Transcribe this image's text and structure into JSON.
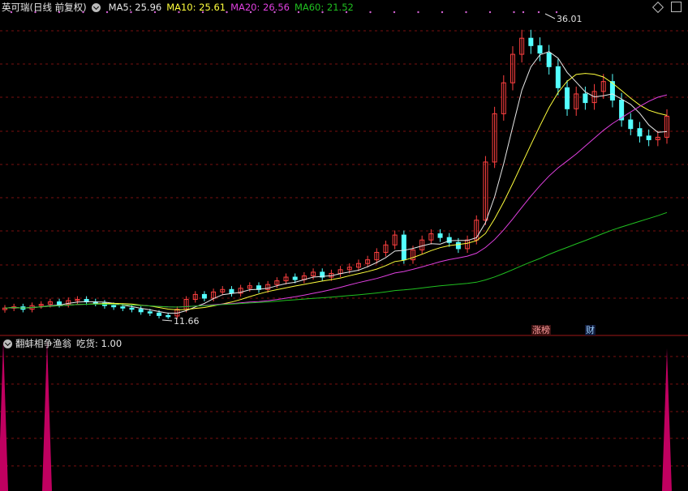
{
  "header": {
    "title": "英可瑞(日线 前复权)",
    "ma5": "MA5: 25.96",
    "ma10": "MA10: 25.61",
    "ma20": "MA20: 26.56",
    "ma60": "MA60: 21.52"
  },
  "annotations": {
    "high_label": "36.01",
    "low_label": "11.66",
    "badge1": "涨榜",
    "badge2": "财"
  },
  "indicator": {
    "title": "翻蚌相争渔翁",
    "value_label": "吃货: 1.00"
  },
  "colors": {
    "up": "#ff4040",
    "down": "#54ffff",
    "ma5": "#e8e8e8",
    "ma10": "#ffff3c",
    "ma20": "#e040e0",
    "ma60": "#20c020",
    "grid": "#7a1010",
    "indicator": "#c00060"
  },
  "chart_data": {
    "type": "candlestick",
    "y_range": [
      11.66,
      36.01
    ],
    "prices": {
      "close_series_approx": [
        12.3,
        12.4,
        12.2,
        12.5,
        12.6,
        12.8,
        12.6,
        12.9,
        13.0,
        12.8,
        12.7,
        12.5,
        12.4,
        12.3,
        12.2,
        12.0,
        11.9,
        11.7,
        11.66,
        12.2,
        13.0,
        13.4,
        13.1,
        13.6,
        13.8,
        13.5,
        13.9,
        14.1,
        13.8,
        14.2,
        14.5,
        14.8,
        14.6,
        14.9,
        15.2,
        14.8,
        15.1,
        15.4,
        15.6,
        15.9,
        16.2,
        16.8,
        17.4,
        18.2,
        16.2,
        17.0,
        17.8,
        18.3,
        18.0,
        17.6,
        17.1,
        17.8,
        19.4,
        24.1,
        28.0,
        30.5,
        32.8,
        34.1,
        33.5,
        32.9,
        31.8,
        30.1,
        28.4,
        29.6,
        28.9,
        29.8,
        30.6,
        29.1,
        27.5,
        26.8,
        26.2,
        25.9,
        26.1,
        27.8
      ]
    },
    "ma_last": {
      "MA5": 25.96,
      "MA10": 25.61,
      "MA20": 26.56,
      "MA60": 21.52
    },
    "indicator_series": {
      "name": "吃货",
      "last": 1.0,
      "spikes_at_bars": [
        0,
        13,
        80
      ]
    }
  }
}
